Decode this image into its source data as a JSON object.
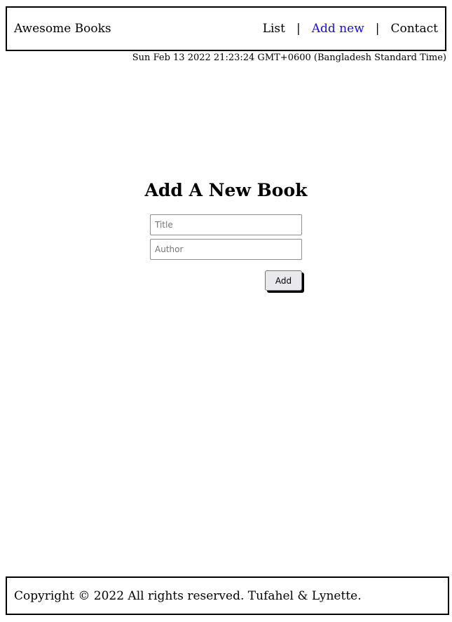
{
  "header": {
    "brand": "Awesome Books",
    "nav": [
      {
        "label": "List",
        "active": false
      },
      {
        "label": "Add new",
        "active": true
      },
      {
        "label": "Contact",
        "active": false
      }
    ],
    "separator": "|",
    "active_color": "#1a0dcc"
  },
  "date_text": "Sun Feb 13 2022 21:23:24 GMT+0600 (Bangladesh Standard Time)",
  "form": {
    "title": "Add A New Book",
    "title_placeholder": "Title",
    "title_value": "",
    "author_placeholder": "Author",
    "author_value": "",
    "submit_label": "Add"
  },
  "footer": {
    "text": "Copyright © 2022 All rights reserved. Tufahel & Lynette."
  }
}
